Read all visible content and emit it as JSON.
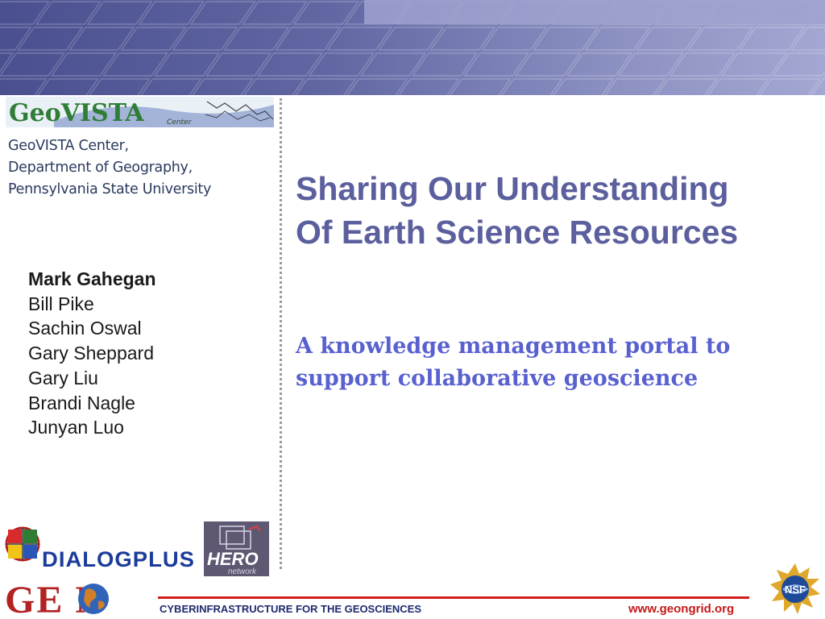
{
  "logos": {
    "geovista": "GeoVISTA",
    "geovista_sub": "Center",
    "dialogplus": "DIALOGPLUS",
    "hero": "HERO",
    "hero_sub": "network",
    "geon": "GE N",
    "nsf": "NSF"
  },
  "affiliation": {
    "line1": "GeoVISTA Center,",
    "line2": "Department of Geography,",
    "line3": "Pennsylvania State University"
  },
  "authors": [
    "Mark Gahegan",
    "Bill Pike",
    "Sachin Oswal",
    "Gary Sheppard",
    "Gary Liu",
    "Brandi Nagle",
    "Junyan Luo"
  ],
  "title": {
    "line1": "Sharing Our Understanding",
    "line2": "Of Earth Science Resources"
  },
  "subtitle": {
    "line1": "A knowledge management portal to",
    "line2": "support collaborative geoscience"
  },
  "footer": {
    "tagline": "CYBERINFRASTRUCTURE FOR THE GEOSCIENCES",
    "url": "www.geongrid.org"
  },
  "colors": {
    "banner": "#5c61a0",
    "title": "#5b5f9d",
    "subtitle": "#5961d0",
    "rule": "#d41d1d",
    "url": "#c41a1a"
  }
}
